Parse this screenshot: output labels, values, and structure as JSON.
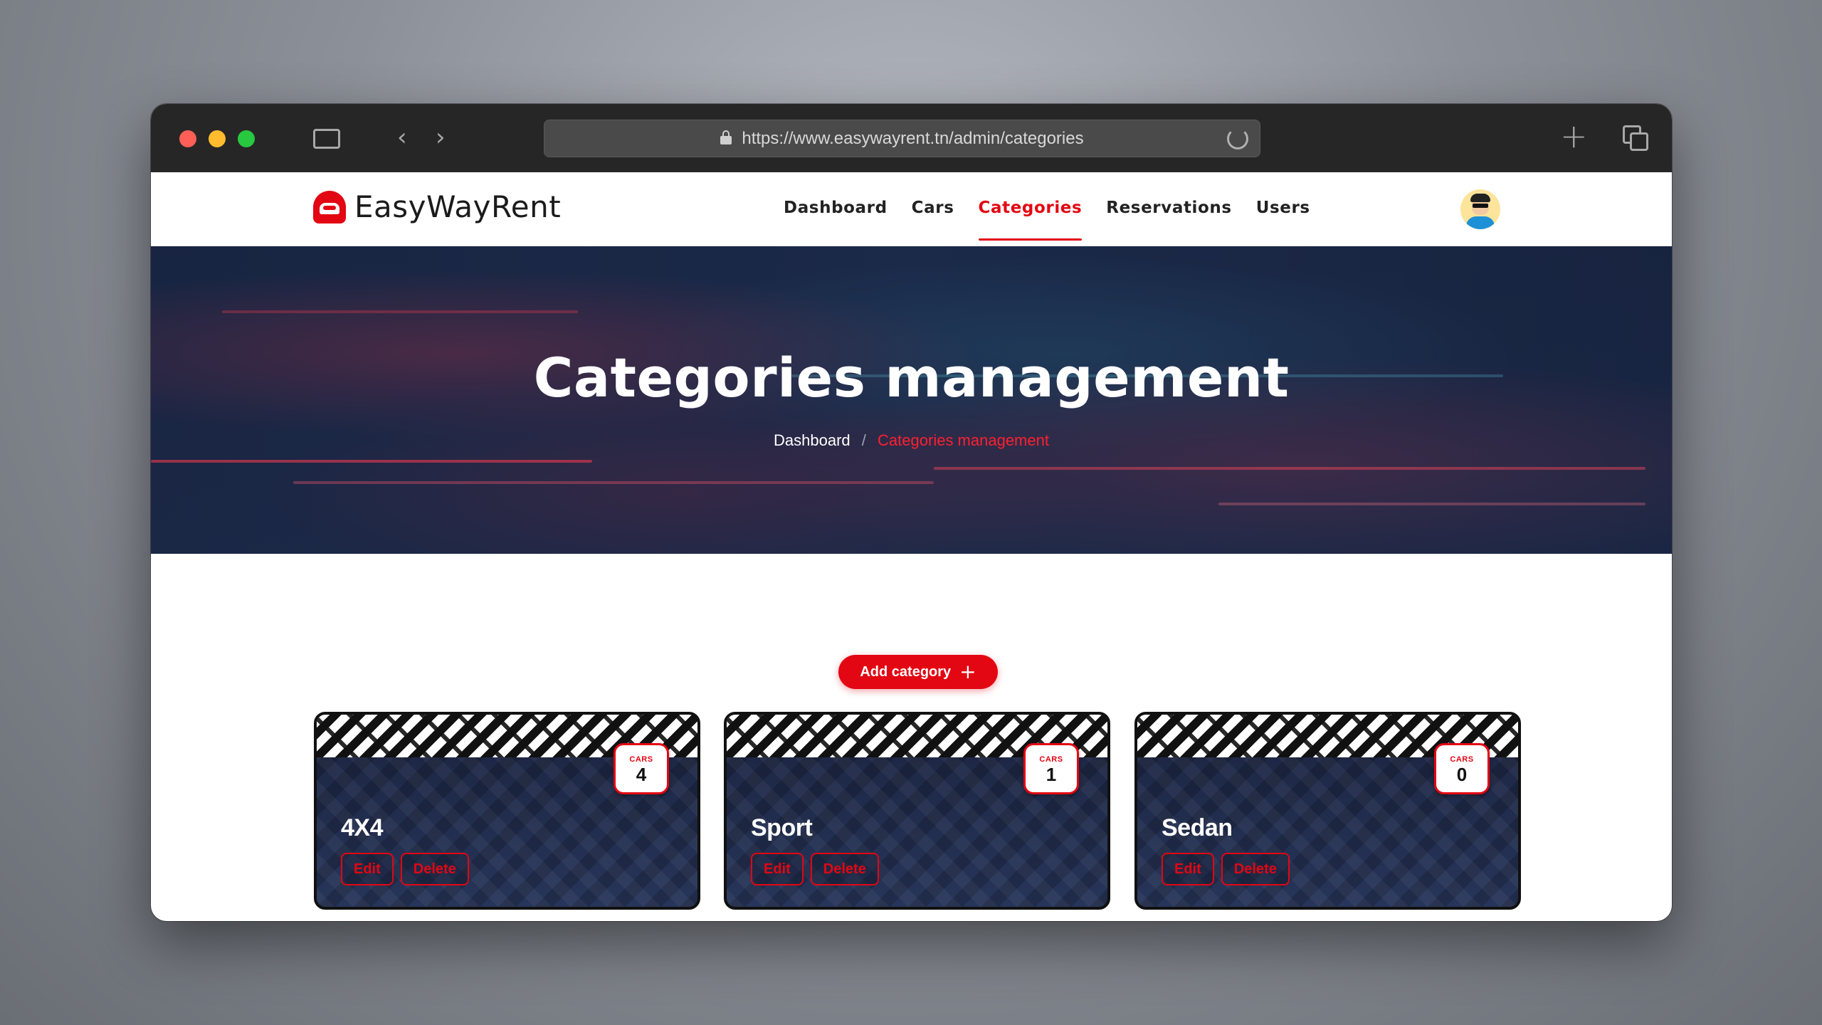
{
  "browser": {
    "url": "https://www.easywayrent.tn/admin/categories"
  },
  "brand": {
    "name": "EasyWayRent",
    "accent_color": "#e30613"
  },
  "nav": {
    "items": [
      {
        "label": "Dashboard",
        "active": false
      },
      {
        "label": "Cars",
        "active": false
      },
      {
        "label": "Categories",
        "active": true
      },
      {
        "label": "Reservations",
        "active": false
      },
      {
        "label": "Users",
        "active": false
      }
    ]
  },
  "hero": {
    "title": "Categories management",
    "breadcrumb": {
      "home": "Dashboard",
      "separator": "/",
      "current": "Categories management"
    }
  },
  "actions": {
    "add_category_label": "Add category"
  },
  "categories": [
    {
      "name": "4X4",
      "cars_label": "CARS",
      "cars_count": "4",
      "edit_label": "Edit",
      "delete_label": "Delete"
    },
    {
      "name": "Sport",
      "cars_label": "CARS",
      "cars_count": "1",
      "edit_label": "Edit",
      "delete_label": "Delete"
    },
    {
      "name": "Sedan",
      "cars_label": "CARS",
      "cars_count": "0",
      "edit_label": "Edit",
      "delete_label": "Delete"
    }
  ]
}
